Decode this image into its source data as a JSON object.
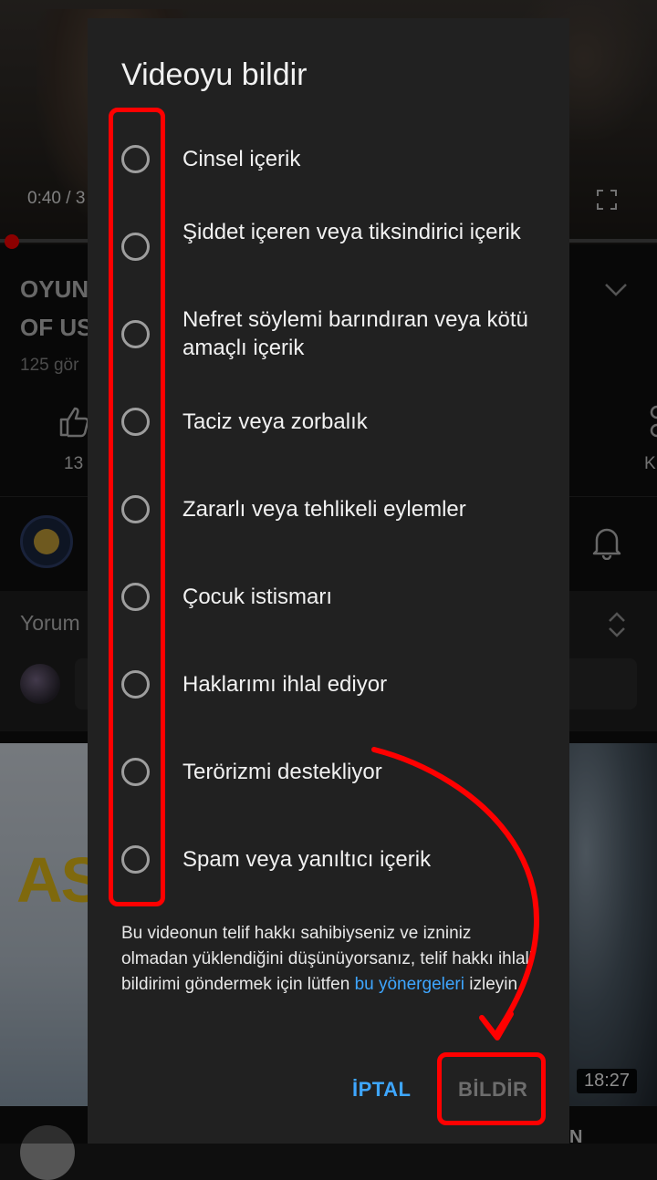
{
  "background": {
    "video_time": "0:40 / 3",
    "title_line1": "OYUN",
    "title_line2": "OF US",
    "views": "125 gör",
    "like_count": "13",
    "right_label": "K",
    "comments_label": "Yorum",
    "duration": "18:27",
    "thumbnail_text": "AS",
    "bottom_letter": "N"
  },
  "dialog": {
    "title": "Videoyu bildir",
    "options": [
      {
        "label": "Cinsel içerik"
      },
      {
        "label": "Şiddet içeren veya tiksindirici içerik"
      },
      {
        "label": "Nefret söylemi barındıran veya kötü amaçlı içerik"
      },
      {
        "label": "Taciz veya zorbalık"
      },
      {
        "label": "Zararlı veya tehlikeli eylemler"
      },
      {
        "label": "Çocuk istismarı"
      },
      {
        "label": "Haklarımı ihlal ediyor"
      },
      {
        "label": "Terörizmi destekliyor"
      },
      {
        "label": "Spam veya yanıltıcı içerik"
      }
    ],
    "note_text": "Bu videonun telif hakkı sahibiyseniz ve izniniz olmadan yüklendiğini düşünüyorsanız, telif hakkı ihlali bildirimi göndermek için lütfen ",
    "note_link": "bu yönergeleri",
    "note_suffix": " izleyin.",
    "cancel_label": "İPTAL",
    "report_label": "BİLDİR"
  },
  "colors": {
    "accent": "#3ea6ff",
    "annotation": "#ff0000",
    "dialog_bg": "#212121"
  }
}
